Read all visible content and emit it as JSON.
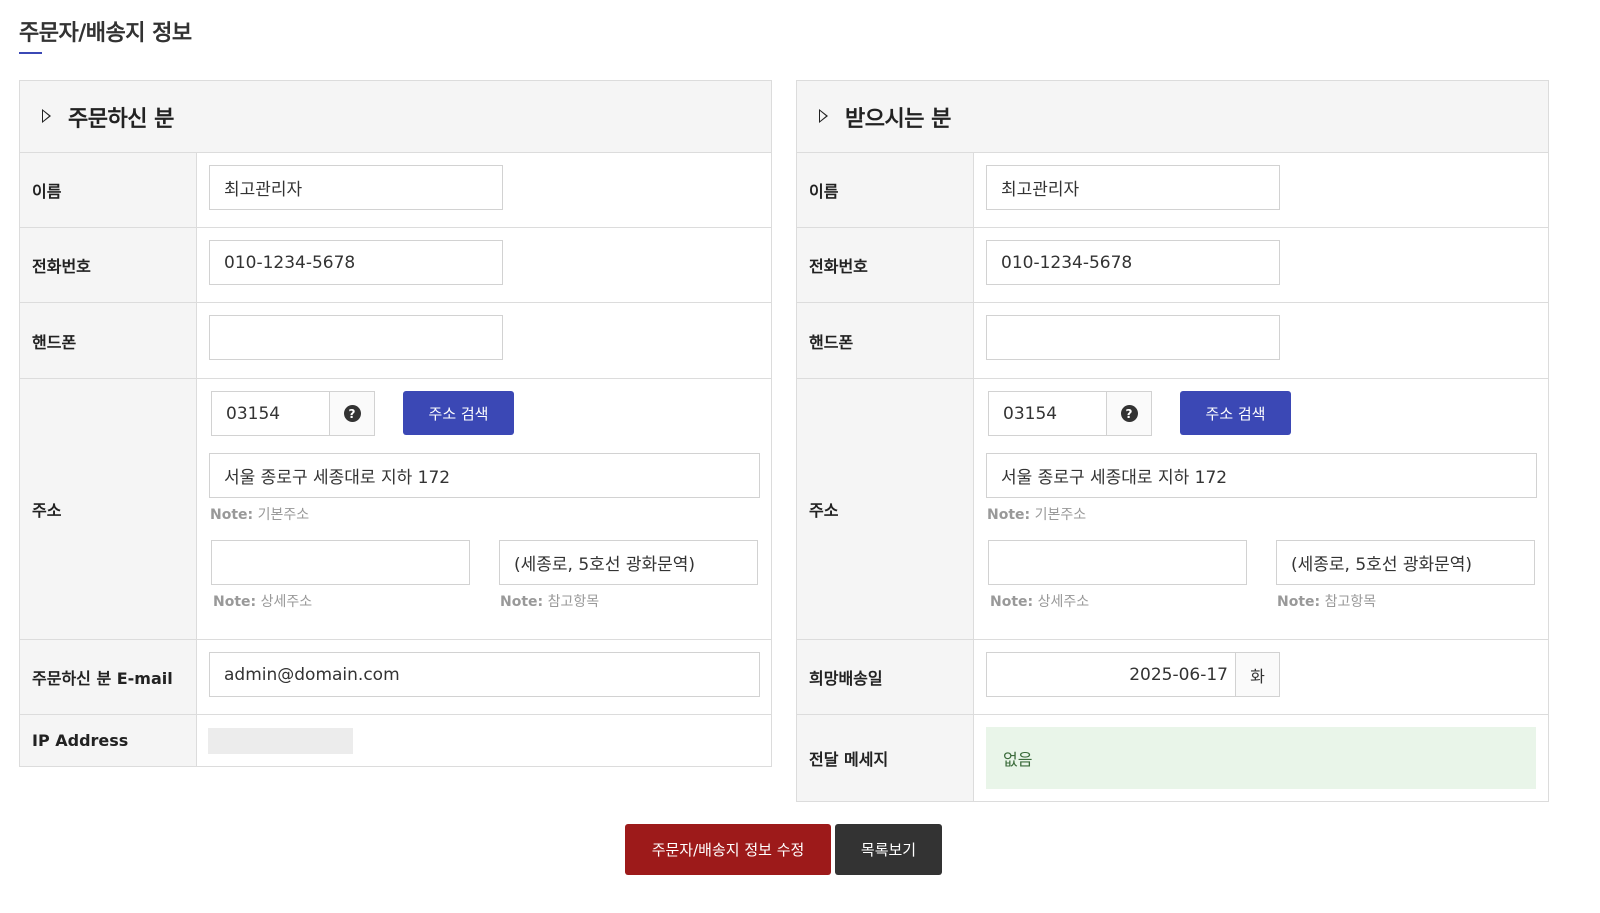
{
  "page_title": "주문자/배송지 정보",
  "orderer": {
    "header": "주문하신 분",
    "name_label": "이름",
    "name_value": "최고관리자",
    "phone_label": "전화번호",
    "phone_value": "010-1234-5678",
    "mobile_label": "핸드폰",
    "mobile_value": "",
    "address_label": "주소",
    "zip_value": "03154",
    "address_search_label": "주소 검색",
    "address_basic_value": "서울 종로구 세종대로 지하 172",
    "note_prefix": "Note:",
    "note_basic": "기본주소",
    "address_detail_value": "",
    "note_detail": "상세주소",
    "address_ref_value": "(세종로, 5호선 광화문역)",
    "note_ref": "참고항목",
    "email_label": "주문하신 분 E-mail",
    "email_value": "admin@domain.com",
    "ip_label": "IP Address"
  },
  "receiver": {
    "header": "받으시는 분",
    "name_label": "이름",
    "name_value": "최고관리자",
    "phone_label": "전화번호",
    "phone_value": "010-1234-5678",
    "mobile_label": "핸드폰",
    "mobile_value": "",
    "address_label": "주소",
    "zip_value": "03154",
    "address_search_label": "주소 검색",
    "address_basic_value": "서울 종로구 세종대로 지하 172",
    "note_prefix": "Note:",
    "note_basic": "기본주소",
    "address_detail_value": "",
    "note_detail": "상세주소",
    "address_ref_value": "(세종로, 5호선 광화문역)",
    "note_ref": "참고항목",
    "delivery_date_label": "희망배송일",
    "delivery_date_value": "2025-06-17",
    "delivery_weekday": "화",
    "message_label": "전달 메세지",
    "message_value": "없음"
  },
  "actions": {
    "submit_label": "주문자/배송지 정보 수정",
    "list_label": "목록보기"
  },
  "colors": {
    "accent_blue": "#3b48b5",
    "submit_red": "#9d1a1a",
    "list_dark": "#333333",
    "message_bg": "#e9f5e9"
  },
  "icons": {
    "help": "question-circle-icon",
    "section": "triangle-right-icon"
  }
}
